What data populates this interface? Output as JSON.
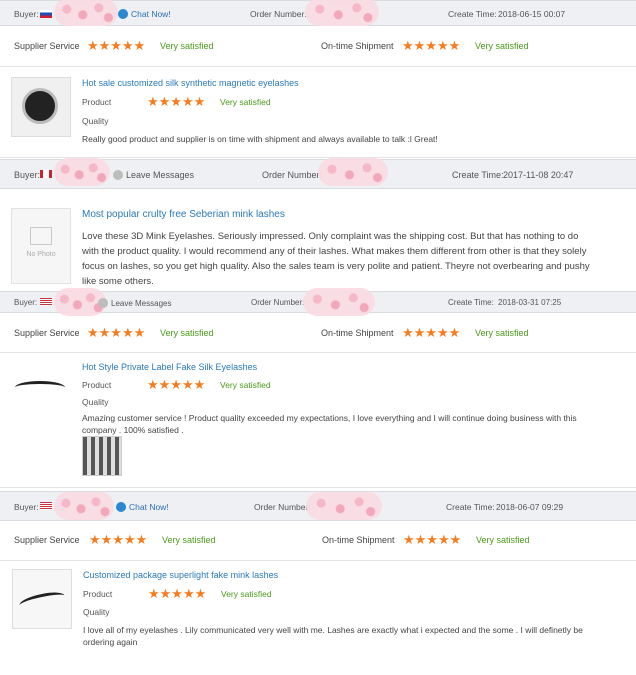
{
  "labels": {
    "buyer": "Buyer:",
    "order_number": "Order Number:",
    "create_time": "Create Time:",
    "supplier_service": "Supplier Service",
    "ontime_shipment": "On-time Shipment",
    "product": "Product",
    "quality": "Quality",
    "very_satisfied": "Very satisfied",
    "stars": "★★★★★",
    "no_photo": "No Photo"
  },
  "reviews": [
    {
      "contact": "Chat Now!",
      "create_time": "2018-06-15 00:07",
      "product_title": "Hot sale customized silk synthetic magnetic eyelashes",
      "text": "Really good product and supplier is on time with shipment and always available to talk :l Great!"
    },
    {
      "contact": "Leave Messages",
      "create_time": "2017-11-08 20:47",
      "product_title": "Most popular crulty free Seberian mink lashes",
      "text": "Love these 3D Mink Eyelashes. Seriously impressed. Only complaint was the shipping cost. But that has nothing to do with the product quality.  I would recommend any of their lashes. What makes them different from other is that they solely focus on lashes, so you get high quality.  Also the sales team is very polite and patient. Theyre not overbearing and pushy like some others."
    },
    {
      "contact": "Leave Messages",
      "create_time": "2018-03-31 07:25",
      "product_title": "Hot Style Private Label Fake Silk Eyelashes",
      "text": "Amazing customer service ! Product quality exceeded my expectations, I love everything and I will continue doing business with this company . 100% satisfied ."
    },
    {
      "contact": "Chat Now!",
      "create_time": "2018-06-07 09:29",
      "product_title": "Customized package superlight fake mink lashes",
      "text": "I love all of my eyelashes . Lily communicated very well with me. Lashes are exactly what i expected and the some . I will definetly be ordering again"
    }
  ]
}
